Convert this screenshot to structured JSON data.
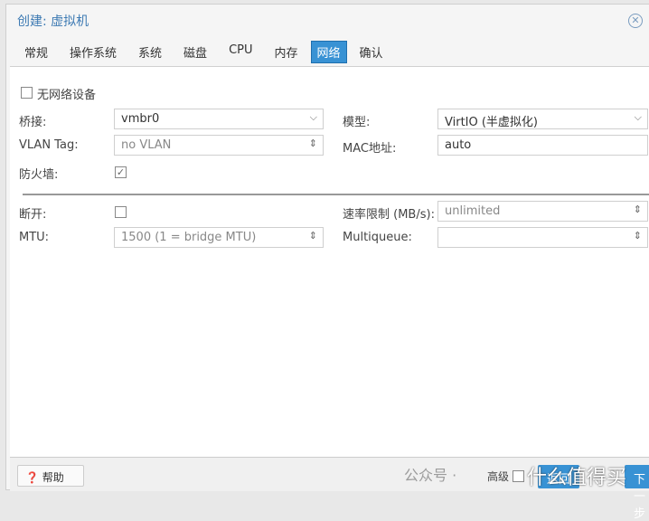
{
  "window": {
    "title": "创建: 虚拟机",
    "close_icon": "close-circle-icon"
  },
  "tabs": [
    {
      "label": "常规"
    },
    {
      "label": "操作系统"
    },
    {
      "label": "系统"
    },
    {
      "label": "磁盘"
    },
    {
      "label": "CPU"
    },
    {
      "label": "内存"
    },
    {
      "label": "网络",
      "active": true
    },
    {
      "label": "确认"
    }
  ],
  "form": {
    "no_network": {
      "label": "无网络设备",
      "checked": false
    },
    "bridge": {
      "label": "桥接:",
      "value": "vmbr0"
    },
    "model": {
      "label": "模型:",
      "value": "VirtIO (半虚拟化)"
    },
    "vlan": {
      "label": "VLAN Tag:",
      "value": "no VLAN"
    },
    "mac": {
      "label": "MAC地址:",
      "value": "auto"
    },
    "firewall": {
      "label": "防火墙:",
      "checked": true
    },
    "disconnect": {
      "label": "断开:",
      "checked": false
    },
    "rate": {
      "label": "速率限制 (MB/s):",
      "value": "unlimited"
    },
    "mtu": {
      "label": "MTU:",
      "value": "1500 (1 = bridge MTU)"
    },
    "multiqueue": {
      "label": "Multiqueue:",
      "value": ""
    }
  },
  "footer": {
    "help": "帮助",
    "advanced": "高级",
    "back": "返回",
    "next": "下一步"
  },
  "watermark": {
    "text": "公众号 · ",
    "brand": "什么值得买"
  }
}
